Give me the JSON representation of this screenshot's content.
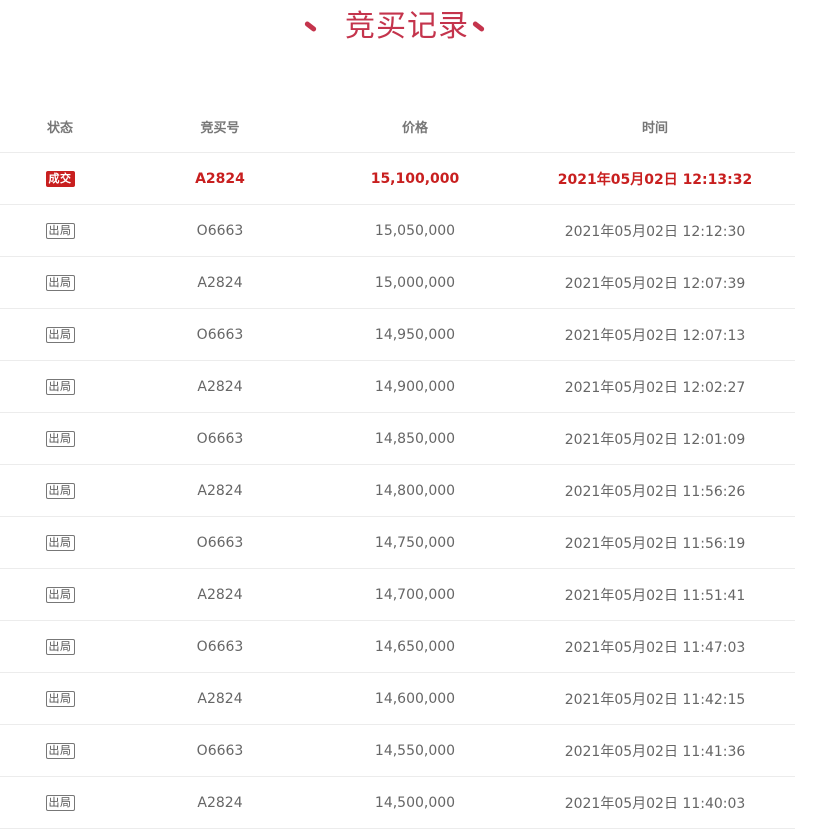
{
  "page": {
    "title": "竞买记录"
  },
  "table": {
    "headers": {
      "status": "状态",
      "bid_no": "竞买号",
      "price": "价格",
      "time": "时间"
    },
    "rows": [
      {
        "status": "成交",
        "bid_no": "A2824",
        "price": "15,100,000",
        "time": "2021年05月02日 12:13:32"
      },
      {
        "status": "出局",
        "bid_no": "O6663",
        "price": "15,050,000",
        "time": "2021年05月02日 12:12:30"
      },
      {
        "status": "出局",
        "bid_no": "A2824",
        "price": "15,000,000",
        "time": "2021年05月02日 12:07:39"
      },
      {
        "status": "出局",
        "bid_no": "O6663",
        "price": "14,950,000",
        "time": "2021年05月02日 12:07:13"
      },
      {
        "status": "出局",
        "bid_no": "A2824",
        "price": "14,900,000",
        "time": "2021年05月02日 12:02:27"
      },
      {
        "status": "出局",
        "bid_no": "O6663",
        "price": "14,850,000",
        "time": "2021年05月02日 12:01:09"
      },
      {
        "status": "出局",
        "bid_no": "A2824",
        "price": "14,800,000",
        "time": "2021年05月02日 11:56:26"
      },
      {
        "status": "出局",
        "bid_no": "O6663",
        "price": "14,750,000",
        "time": "2021年05月02日 11:56:19"
      },
      {
        "status": "出局",
        "bid_no": "A2824",
        "price": "14,700,000",
        "time": "2021年05月02日 11:51:41"
      },
      {
        "status": "出局",
        "bid_no": "O6663",
        "price": "14,650,000",
        "time": "2021年05月02日 11:47:03"
      },
      {
        "status": "出局",
        "bid_no": "A2824",
        "price": "14,600,000",
        "time": "2021年05月02日 11:42:15"
      },
      {
        "status": "出局",
        "bid_no": "O6663",
        "price": "14,550,000",
        "time": "2021年05月02日 11:41:36"
      },
      {
        "status": "出局",
        "bid_no": "A2824",
        "price": "14,500,000",
        "time": "2021年05月02日 11:40:03"
      }
    ]
  },
  "colors": {
    "accent": "#c4344c",
    "winner": "#c81f1f",
    "text": "#666666"
  }
}
